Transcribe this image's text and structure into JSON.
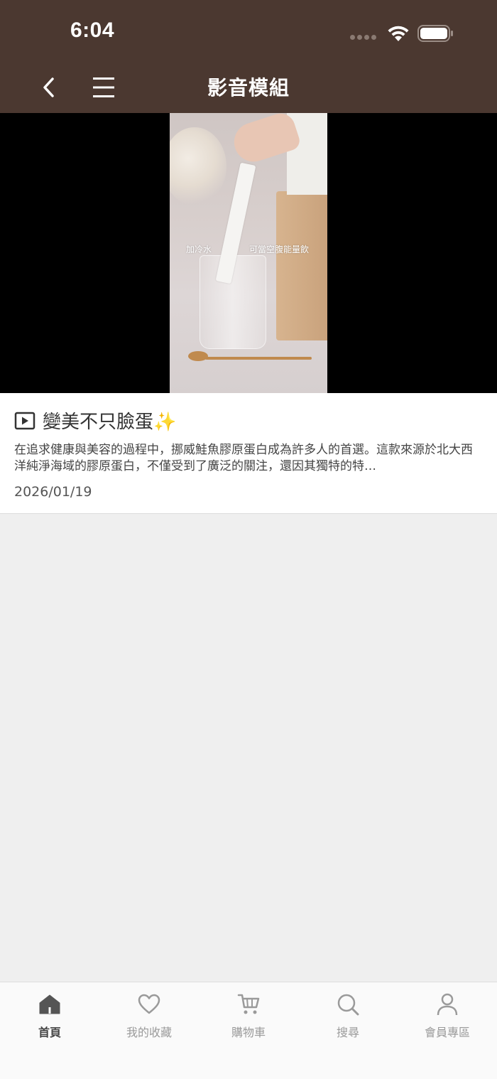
{
  "status_bar": {
    "time": "6:04"
  },
  "nav": {
    "title": "影音模組"
  },
  "video": {
    "caption_left": "加冷水",
    "caption_right": "可當空腹能量飲"
  },
  "card": {
    "title": "變美不只臉蛋✨",
    "description": "在追求健康與美容的過程中，挪威鮭魚膠原蛋白成為許多人的首選。這款來源於北大西洋純淨海域的膠原蛋白，不僅受到了廣泛的關注，還因其獨特的特…",
    "date": "2026/01/19"
  },
  "tabbar": {
    "items": [
      {
        "label": "首頁",
        "icon": "home-icon",
        "active": true
      },
      {
        "label": "我的收藏",
        "icon": "heart-icon",
        "active": false
      },
      {
        "label": "購物車",
        "icon": "cart-icon",
        "active": false
      },
      {
        "label": "搜尋",
        "icon": "search-icon",
        "active": false
      },
      {
        "label": "會員專區",
        "icon": "user-icon",
        "active": false
      }
    ]
  },
  "colors": {
    "header_bg": "#4b3830",
    "page_bg": "#efefef",
    "tab_active": "#444444",
    "tab_inactive": "#9a9a9a"
  }
}
